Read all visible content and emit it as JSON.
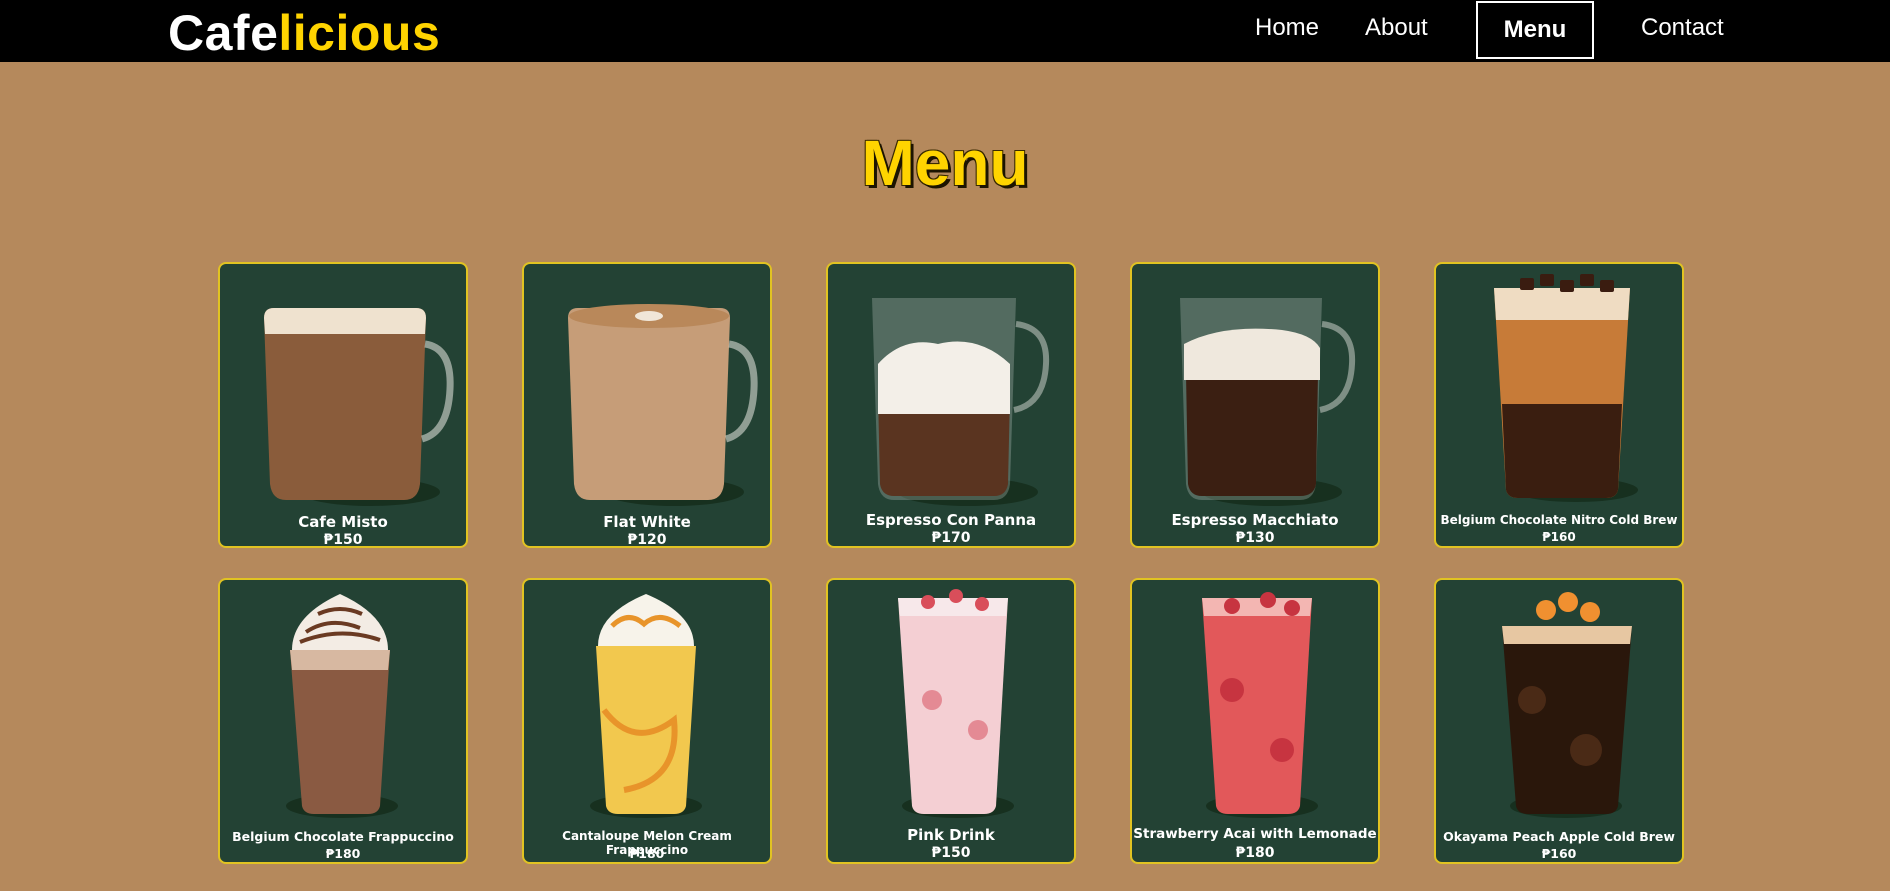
{
  "brand": {
    "part1": "Cafe",
    "part2": "licious"
  },
  "nav": {
    "home": "Home",
    "about": "About",
    "menu": "Menu",
    "contact": "Contact"
  },
  "page": {
    "title": "Menu"
  },
  "colors": {
    "background": "#b5895c",
    "navbar": "#000000",
    "accent": "#ffd400",
    "card": "#234234",
    "card_border": "#e1c322"
  },
  "menu_items": [
    {
      "name": "Cafe Misto",
      "price": "₱150"
    },
    {
      "name": "Flat White",
      "price": "₱120"
    },
    {
      "name": "Espresso Con Panna",
      "price": "₱170"
    },
    {
      "name": "Espresso Macchiato",
      "price": "₱130"
    },
    {
      "name": "Belgium Chocolate Nitro Cold Brew",
      "price": "₱160"
    },
    {
      "name": "Belgium Chocolate Frappuccino",
      "price": "₱180"
    },
    {
      "name": "Cantaloupe Melon Cream Frappuccino",
      "price": "₱180"
    },
    {
      "name": "Pink Drink",
      "price": "₱150"
    },
    {
      "name": "Strawberry Acai with Lemonade",
      "price": "₱180"
    },
    {
      "name": "Okayama Peach Apple Cold Brew",
      "price": "₱160"
    }
  ]
}
